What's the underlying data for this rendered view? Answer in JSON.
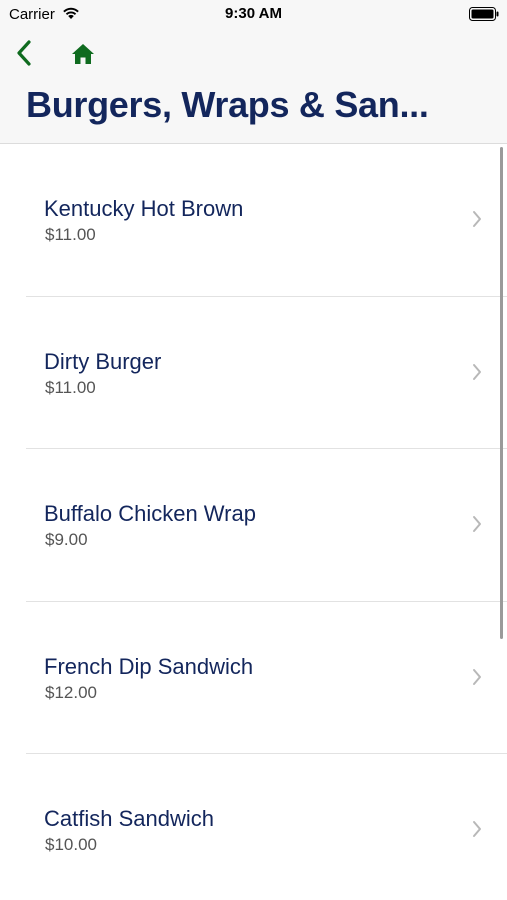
{
  "status_bar": {
    "carrier": "Carrier",
    "time": "9:30 AM",
    "icons": [
      "wifi-icon",
      "battery-icon"
    ]
  },
  "header": {
    "back_icon": "chevron-left-icon",
    "home_icon": "home-icon",
    "title": "Burgers, Wraps & San...",
    "accent_color": "#0f6b1f",
    "title_color": "#13265c"
  },
  "menu_items": [
    {
      "name": "Kentucky Hot Brown",
      "price": "$11.00"
    },
    {
      "name": "Dirty Burger",
      "price": "$11.00"
    },
    {
      "name": "Buffalo Chicken Wrap",
      "price": "$9.00"
    },
    {
      "name": "French Dip Sandwich",
      "price": "$12.00"
    },
    {
      "name": "Catfish Sandwich",
      "price": "$10.00"
    }
  ]
}
